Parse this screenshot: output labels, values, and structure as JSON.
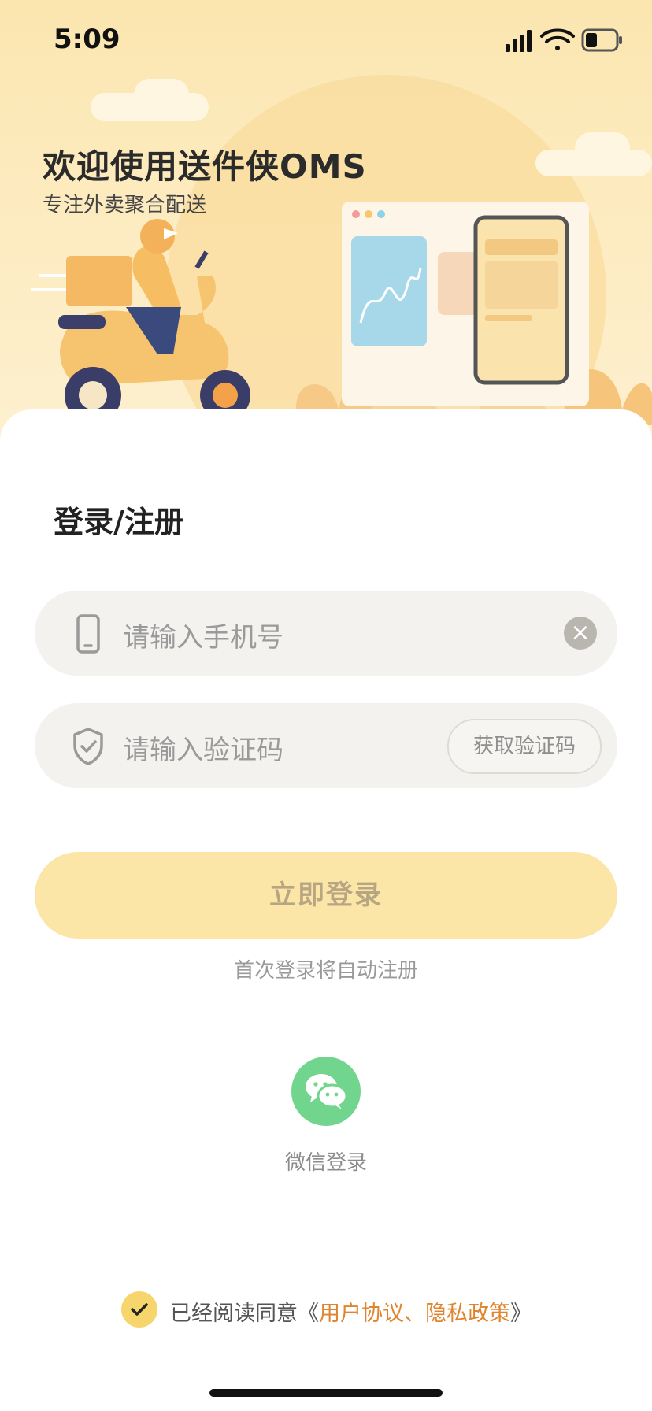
{
  "status_bar": {
    "time": "5:09"
  },
  "hero": {
    "title": "欢迎使用送件侠OMS",
    "subtitle": "专注外卖聚合配送"
  },
  "form": {
    "section_title": "登录/注册",
    "phone_placeholder": "请输入手机号",
    "code_placeholder": "请输入验证码",
    "get_code_label": "获取验证码",
    "login_label": "立即登录",
    "auto_register_hint": "首次登录将自动注册"
  },
  "social": {
    "wechat_label": "微信登录"
  },
  "agreement": {
    "prefix": "已经阅读同意《",
    "links": "用户协议、隐私政策",
    "suffix": "》",
    "checked": true
  },
  "colors": {
    "accent": "#f7d56d",
    "login_button": "#fbe6a8",
    "wechat": "#72d58e",
    "link": "#e0852f"
  }
}
